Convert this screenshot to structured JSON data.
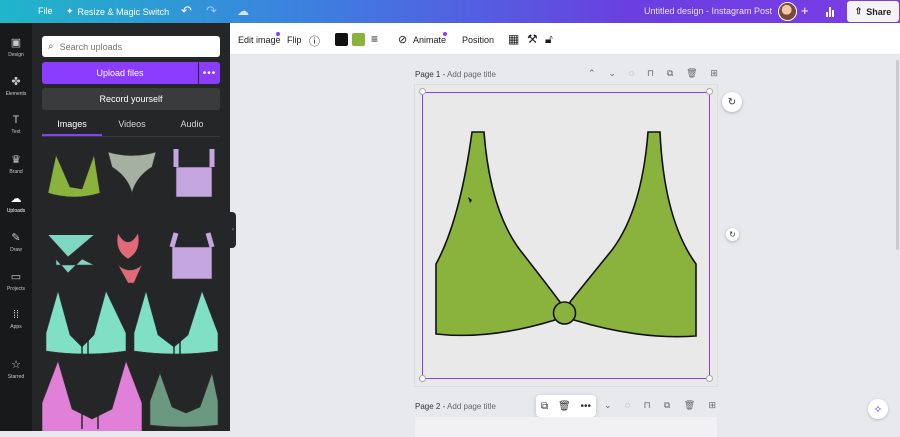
{
  "topbar": {
    "file": "File",
    "resize": "Resize & Magic Switch",
    "title": "Untitled design - Instagram Post",
    "share": "Share"
  },
  "rail": [
    {
      "label": "Design",
      "icon": "design-icon"
    },
    {
      "label": "Elements",
      "icon": "elements-icon"
    },
    {
      "label": "Text",
      "icon": "text-icon"
    },
    {
      "label": "Brand",
      "icon": "brand-icon"
    },
    {
      "label": "Uploads",
      "icon": "uploads-icon"
    },
    {
      "label": "Draw",
      "icon": "draw-icon"
    },
    {
      "label": "Projects",
      "icon": "projects-icon"
    },
    {
      "label": "Apps",
      "icon": "apps-icon"
    },
    {
      "label": "Starred",
      "icon": "starred-icon"
    }
  ],
  "panel": {
    "search_placeholder": "Search uploads",
    "upload_button": "Upload files",
    "record_button": "Record yourself",
    "tabs": [
      "Images",
      "Videos",
      "Audio"
    ]
  },
  "toolbar": {
    "edit_image": "Edit image",
    "flip": "Flip",
    "animate": "Animate",
    "position": "Position",
    "colors": [
      "#111111",
      "#8ab33e"
    ]
  },
  "canvas": {
    "page1_label": "Page 1 -",
    "page1_add_title": "Add page title",
    "page2_label": "Page 2 -",
    "page2_add_title": "Add page title",
    "design_color": "#8ab33e"
  }
}
